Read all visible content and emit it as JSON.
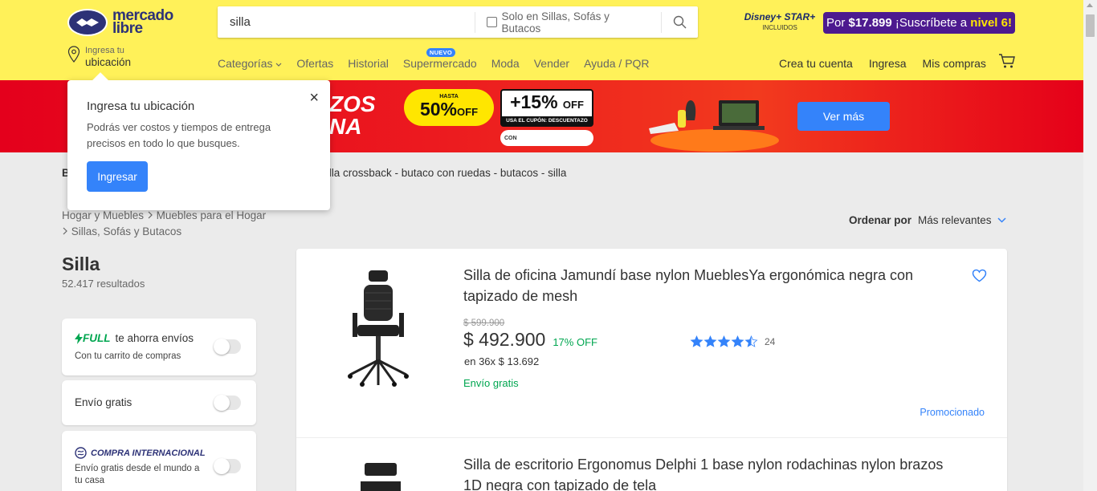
{
  "header": {
    "logo_text_1": "mercado",
    "logo_text_2": "libre",
    "search_value": "silla",
    "search_filter_label": "Solo en Sillas, Sofás y Butacos",
    "disney_label": "Disney+ STAR+",
    "disney_sub": "INCLUIDOS",
    "promo_prefix": "Por",
    "promo_price": "$17.899",
    "promo_middle": "¡Suscríbete a",
    "promo_level": "nivel 6",
    "promo_suffix": "!",
    "location_small": "Ingresa tu",
    "location_big": "ubicación",
    "nav": [
      "Categorías",
      "Ofertas",
      "Historial",
      "Supermercado",
      "Moda",
      "Vender",
      "Ayuda / PQR"
    ],
    "nuevo_badge": "NUEVO",
    "user_nav": [
      "Crea tu cuenta",
      "Ingresa",
      "Mis compras"
    ],
    "accent": "#fff159"
  },
  "banner": {
    "title_1": "ZOS",
    "title_2": "NA",
    "hasta": "HASTA",
    "discount_big": "50%",
    "discount_unit": "OFF",
    "coupon_big": "+15%",
    "coupon_unit": "OFF",
    "coupon_text": "USA EL CUPÓN: DESCUENTAZO",
    "con_label": "CON",
    "cta": "Ver más"
  },
  "popup": {
    "title": "Ingresa tu ubicación",
    "body": "Podrás ver costos y tiempos de entrega precisos en todo lo que busques.",
    "button": "Ingresar",
    "close": "×"
  },
  "related": {
    "label": "B",
    "text": "silla crossback  -  butaco con ruedas  -  butacos  -  silla"
  },
  "breadcrumb": {
    "level1": "Hogar y Muebles",
    "level2": "Muebles para el Hogar",
    "level3": "Sillas, Sofás y Butacos"
  },
  "sort": {
    "label": "Ordenar por",
    "value": "Más relevantes"
  },
  "results": {
    "title": "Silla",
    "count": "52.417 resultados"
  },
  "filters": {
    "full_word": "FULL",
    "full_label": "te ahorra envíos",
    "full_sub": "Con tu carrito de compras",
    "free_shipping": "Envío gratis",
    "intl_label": "COMPRA INTERNACIONAL",
    "intl_sub": "Envío gratis desde el mundo a tu casa"
  },
  "products": [
    {
      "title": "Silla de oficina Jamundí base nylon MueblesYa ergonómica negra con tapizado de mesh",
      "old_price": "$ 599.900",
      "price": "$ 492.900",
      "discount": "17% OFF",
      "installments": "en 36x $ 13.692",
      "shipping": "Envío gratis",
      "rating_count": "24",
      "rating": 4.5,
      "promoted": "Promocionado"
    },
    {
      "title": "Silla de escritorio Ergonomus Delphi 1 base nylon rodachinas nylon brazos 1D negra con tapizado de tela"
    }
  ]
}
